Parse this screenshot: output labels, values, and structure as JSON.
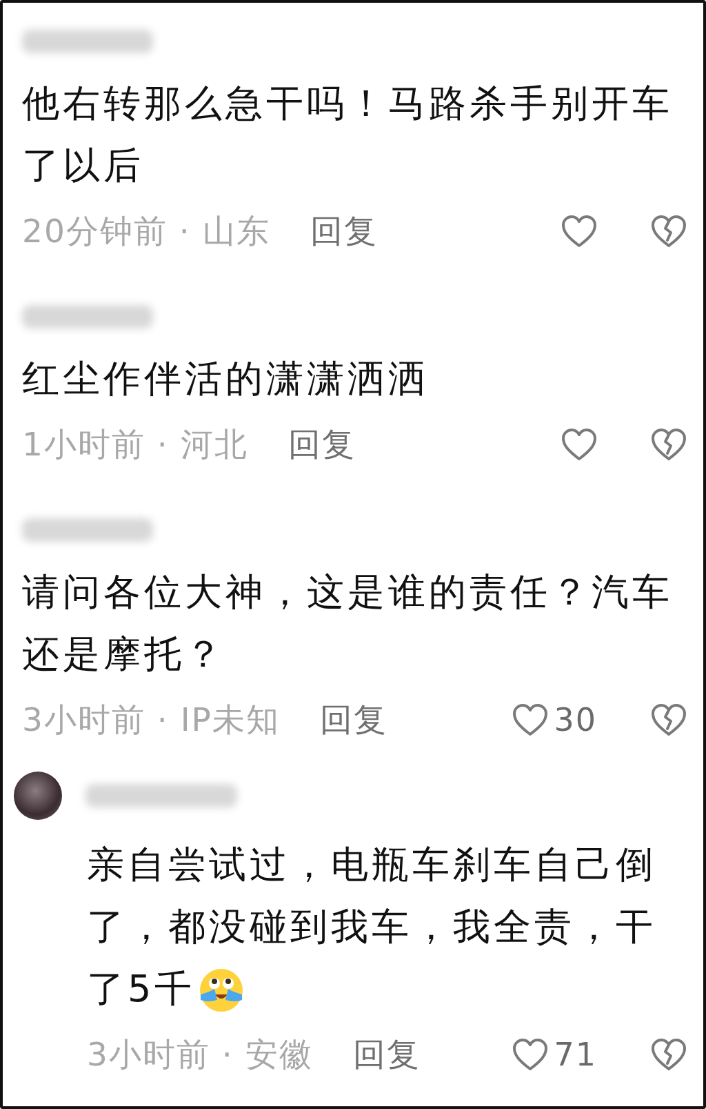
{
  "comments": [
    {
      "kind": "comment",
      "lines": [
        "他右转那么急干吗！马路杀手别开车",
        "了以后"
      ],
      "meta": "20分钟前 · 山东",
      "reply_label": "回复"
    },
    {
      "kind": "comment",
      "lines": [
        "红尘作伴活的潇潇洒洒"
      ],
      "meta": "1小时前 · 河北",
      "reply_label": "回复"
    },
    {
      "kind": "comment",
      "lines": [
        "请问各位大神，这是谁的责任？汽车",
        "还是摩托？"
      ],
      "meta": "3小时前 · IP未知",
      "reply_label": "回复",
      "likes": "30"
    },
    {
      "kind": "reply",
      "lines": [
        "亲自尝试过，电瓶车刹车自己倒",
        "了，都没碰到我车，我全责，干",
        "了5千"
      ],
      "trailing_emoji": true,
      "meta": "3小时前 · 安徽",
      "reply_label": "回复",
      "likes": "71"
    }
  ]
}
